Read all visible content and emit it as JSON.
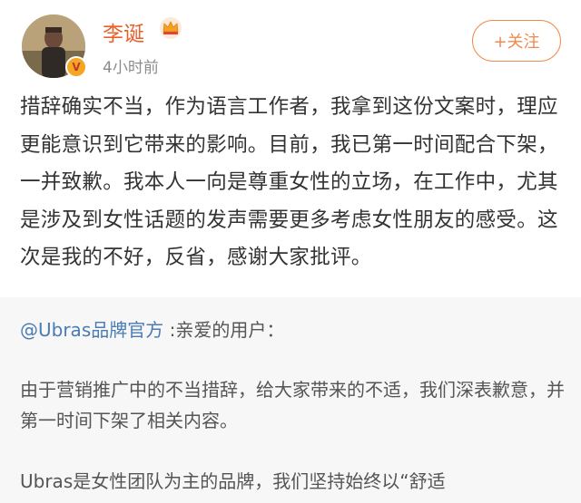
{
  "user": {
    "name": "李诞",
    "time": "4小时前",
    "follow_label": "+关注"
  },
  "post": {
    "text": "措辞确实不当，作为语言工作者，我拿到这份文案时，理应更能意识到它带来的影响。目前，我已第一时间配合下架，一并致歉。我本人一向是尊重女性的立场，在工作中，尤其是涉及到女性话题的发声需要更多考虑女性朋友的感受。这次是我的不好，反省，感谢大家批评。"
  },
  "repost": {
    "mention": "@Ubras品牌官方",
    "greeting": ":亲爱的用户：",
    "para1": "由于营销推广中的不当措辞，给大家带来的不适，我们深表歉意，并第一时间下架了相关内容。",
    "para2": "Ubras是女性团队为主的品牌，我们坚持始终以“舒适"
  },
  "colors": {
    "username": "#e8612c",
    "follow": "#f08b4f",
    "mention": "#4a7bb5",
    "quote_bg": "#f7f7f7"
  },
  "icons": {
    "verified": "verified-badge-icon",
    "crown": "crown-icon"
  }
}
